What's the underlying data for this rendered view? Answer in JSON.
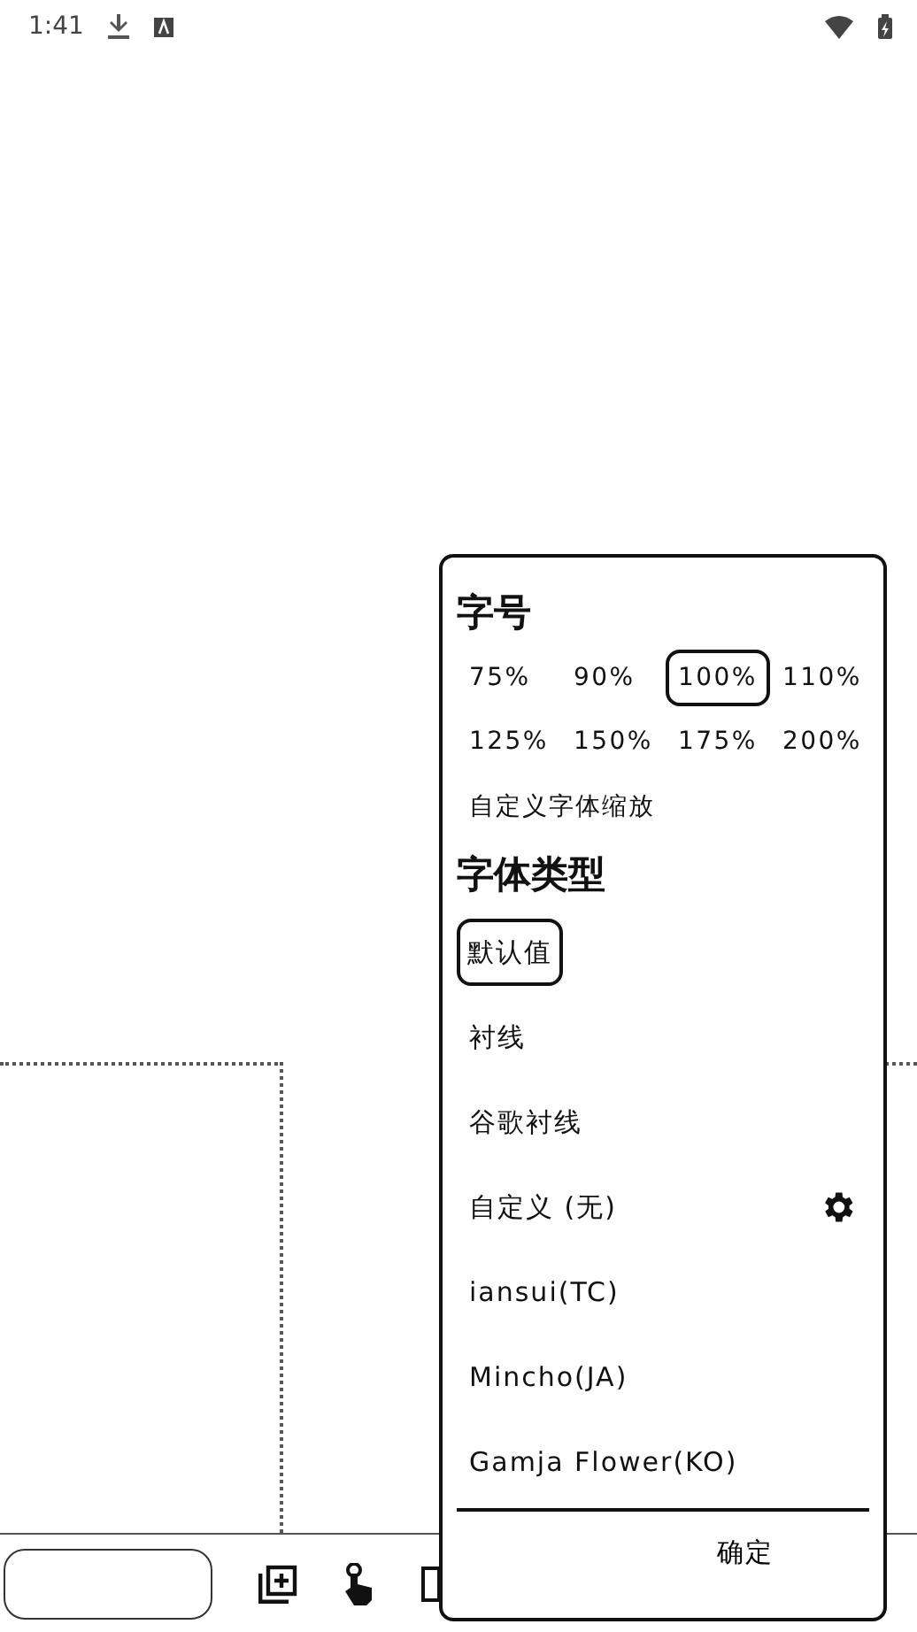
{
  "status_bar": {
    "time": "1:41"
  },
  "font_size": {
    "title": "字号",
    "options": [
      {
        "label": "75%",
        "selected": false
      },
      {
        "label": "90%",
        "selected": false
      },
      {
        "label": "100%",
        "selected": true
      },
      {
        "label": "110%",
        "selected": false
      },
      {
        "label": "125%",
        "selected": false
      },
      {
        "label": "150%",
        "selected": false
      },
      {
        "label": "175%",
        "selected": false
      },
      {
        "label": "200%",
        "selected": false
      }
    ],
    "custom_label": "自定义字体缩放"
  },
  "font_type": {
    "title": "字体类型",
    "options": [
      {
        "label": "默认值",
        "selected": true,
        "kind": "plain"
      },
      {
        "label": "衬线",
        "selected": false,
        "kind": "plain"
      },
      {
        "label": "谷歌衬线",
        "selected": false,
        "kind": "plain"
      },
      {
        "label": "自定义 (无)",
        "selected": false,
        "kind": "custom"
      },
      {
        "label": "iansui(TC)",
        "selected": false,
        "kind": "plain"
      },
      {
        "label": "Mincho(JA)",
        "selected": false,
        "kind": "plain"
      },
      {
        "label": "Gamja Flower(KO)",
        "selected": false,
        "kind": "plain"
      }
    ]
  },
  "confirm_button": "确定"
}
